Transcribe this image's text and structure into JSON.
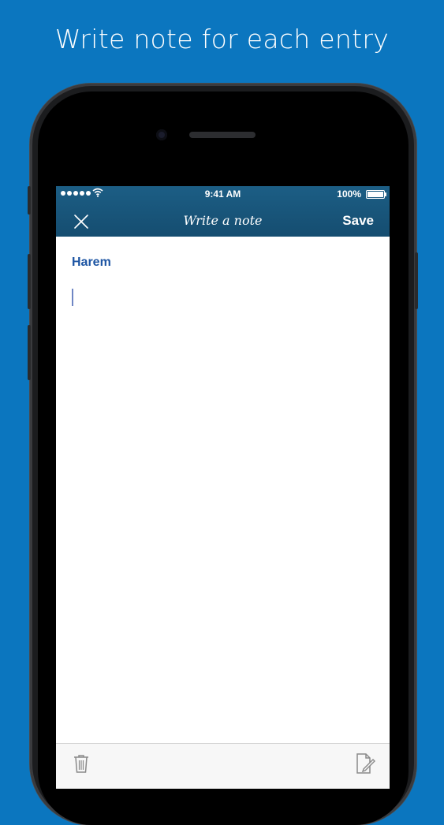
{
  "headline": "Write note for each entry",
  "status_bar": {
    "time": "9:41 AM",
    "battery_text": "100%",
    "battery_level": 1.0
  },
  "nav": {
    "title": "Write a note",
    "save_label": "Save",
    "close_icon": "close-icon"
  },
  "entry": {
    "title": "Harem"
  },
  "note": {
    "value": ""
  },
  "toolbar": {
    "left_icon": "trash-icon",
    "right_icon": "compose-icon"
  },
  "colors": {
    "background": "#0b76bf",
    "nav_bar": "#1a577c",
    "entry_title": "#1d55a3"
  }
}
